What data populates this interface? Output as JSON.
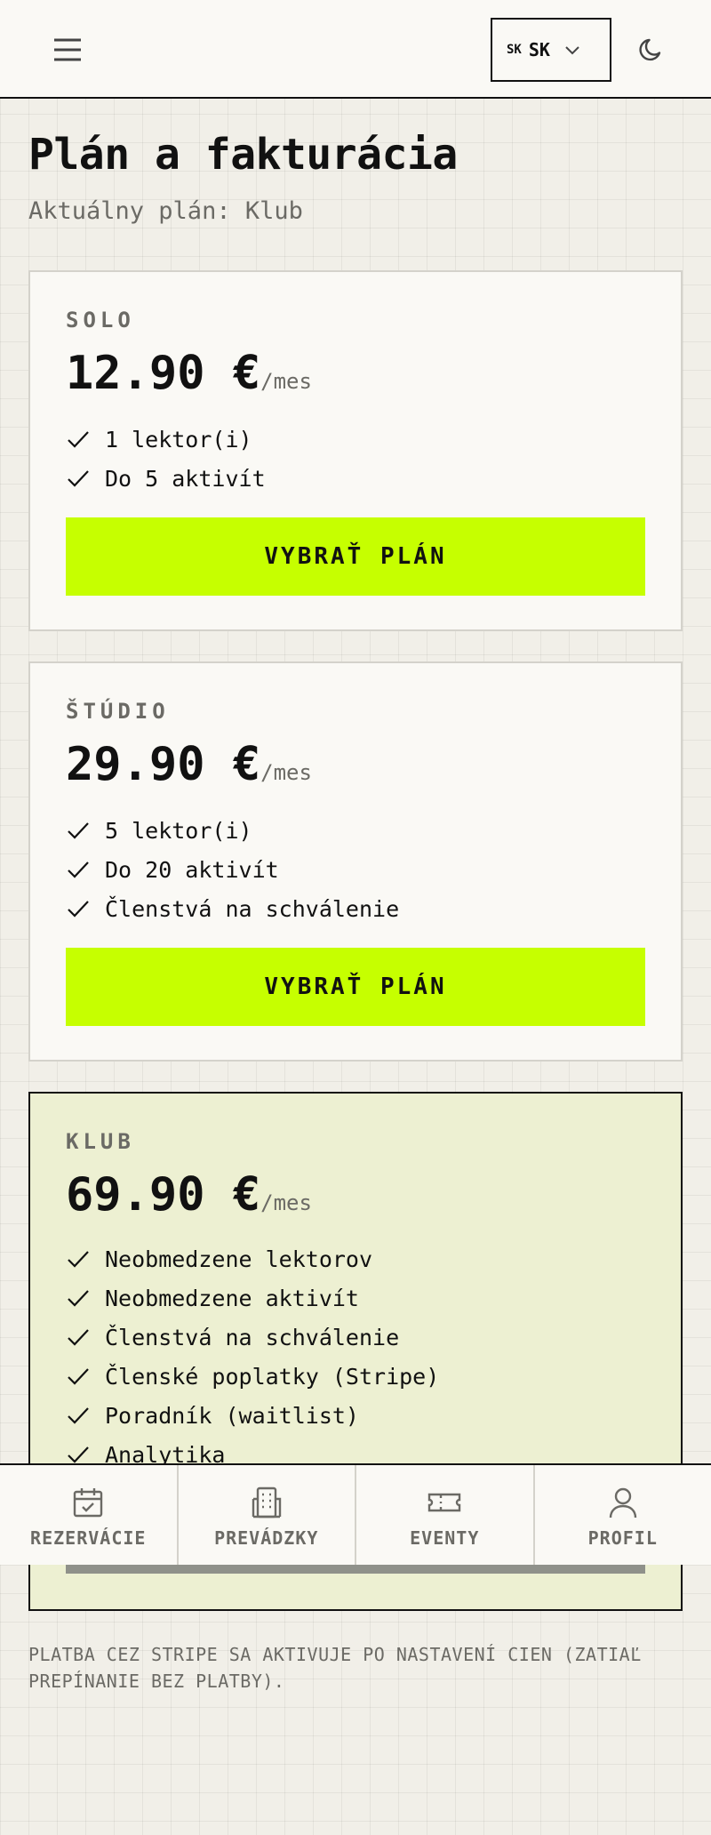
{
  "header": {
    "menu_icon": "hamburger-menu-icon",
    "language": {
      "flag_text": "SK",
      "code": "SK",
      "chevron_icon": "chevron-down-icon"
    },
    "theme_icon": "moon-icon"
  },
  "page": {
    "title": "Plán a fakturácia",
    "subtitle": "Aktuálny plán: Klub"
  },
  "plans": [
    {
      "name": "SOLO",
      "price": "12.90 €",
      "period": "/mes",
      "features": [
        "1 lektor(i)",
        "Do 5 aktivít"
      ],
      "button_label": "VYBRAŤ PLÁN",
      "current": false
    },
    {
      "name": "ŠTÚDIO",
      "price": "29.90 €",
      "period": "/mes",
      "features": [
        "5 lektor(i)",
        "Do 20 aktivít",
        "Členstvá na schválenie"
      ],
      "button_label": "VYBRAŤ PLÁN",
      "current": false
    },
    {
      "name": "KLUB",
      "price": "69.90 €",
      "period": "/mes",
      "features": [
        "Neobmedzene lektorov",
        "Neobmedzene aktivít",
        "Členstvá na schválenie",
        "Členské poplatky (Stripe)",
        "Poradník (waitlist)",
        "Analytika"
      ],
      "current": true
    }
  ],
  "footnote": "PLATBA CEZ STRIPE SA AKTIVUJE PO NASTAVENÍ CIEN (ZATIAĽ PREPÍNANIE BEZ PLATBY).",
  "bottom_nav": [
    {
      "label": "REZERVÁCIE",
      "icon": "calendar-check-icon"
    },
    {
      "label": "PREVÁDZKY",
      "icon": "building-icon"
    },
    {
      "label": "EVENTY",
      "icon": "ticket-icon"
    },
    {
      "label": "PROFIL",
      "icon": "user-icon"
    }
  ],
  "colors": {
    "accent": "#c6ff00",
    "current_plan_bg": "#edf0d2",
    "muted_text": "#6b6a65",
    "page_bg": "#f1efe8"
  }
}
